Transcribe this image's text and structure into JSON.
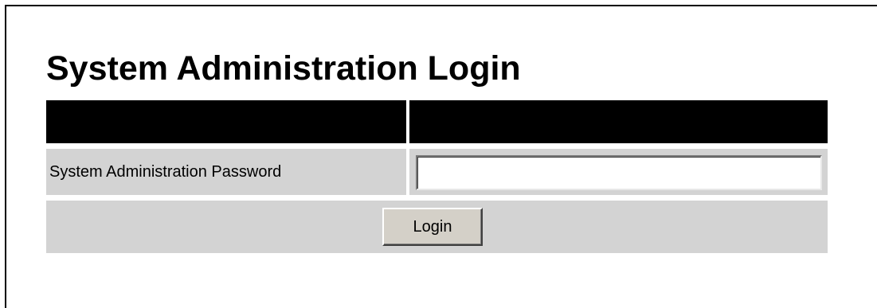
{
  "page": {
    "title": "System Administration Login"
  },
  "form": {
    "password_label": "System Administration Password",
    "password_value": "",
    "password_placeholder": "",
    "login_button_label": "Login"
  },
  "colors": {
    "header_band": "#000000",
    "row_background": "#d3d3d3",
    "button_face": "#d4d0c8"
  }
}
